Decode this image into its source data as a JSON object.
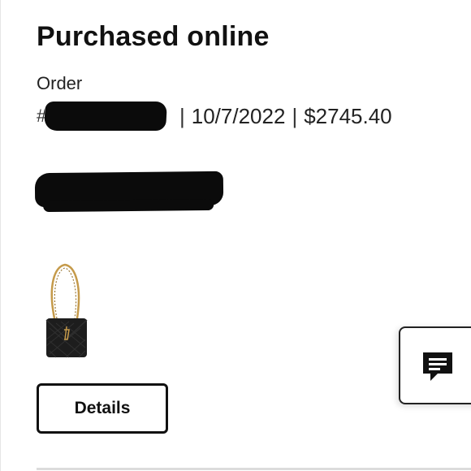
{
  "header": {
    "title": "Purchased online"
  },
  "order": {
    "label": "Order",
    "number_prefix": "#",
    "separator": "|",
    "date": "10/7/2022",
    "total": "$2745.40"
  },
  "product": {
    "image_icon": "shoulder-bag-image"
  },
  "actions": {
    "details_label": "Details"
  },
  "chat": {
    "icon": "chat-icon"
  },
  "colors": {
    "text": "#111111",
    "border": "#111111",
    "redaction": "#0b0b0b",
    "bag": "#1d1d1d",
    "chain": "#c59a4a"
  }
}
